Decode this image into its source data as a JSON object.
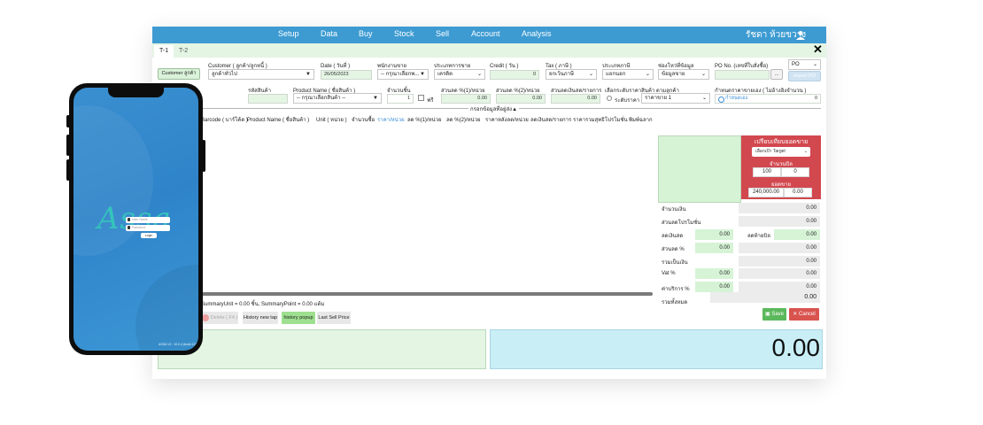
{
  "nav": {
    "items": [
      "Setup",
      "Data",
      "Buy",
      "Stock",
      "Sell",
      "Account",
      "Analysis"
    ],
    "user": "รัชดา ห้วยขวาง",
    "user_icon": "person-icon"
  },
  "tabs": [
    "T-1",
    "T-2"
  ],
  "form": {
    "customer_button": "Customer ลูกค้า",
    "customer_label": "Customer ( ลูกค้า/ลูกหนี้ )",
    "customer_value": "ลูกค้าทั่วไป",
    "date_label": "Date ( วันที่ )",
    "date_value": "26/05/2023",
    "salesperson_label": "พนักงานขาย",
    "salesperson_value": "-- กรุณาเลือกพ...",
    "sale_type_label": "ประเภทการขาย",
    "sale_type_value": "เครดิต",
    "credit_label": "Credit ( วัน )",
    "credit_value": "0",
    "tax_label": "Tax ( ภาษี )",
    "tax_value": "ยกเว้นภาษี",
    "vat_type_label": "ประเภทภาษี",
    "vat_type_value": "แยกนอก",
    "source_label": "ช่องโหว่ที่ข้อมูล",
    "source_value": "ข้อมูลขาย",
    "po_label": "PO No. (เลขที่ใบสั่งซื้อ)",
    "po_dots": "...",
    "po_type": "PO",
    "import_po": "Import PO",
    "product_code_label": "รหัสสินค้า",
    "product_name_label": "Product Name ( ชื่อสินค้า )",
    "product_name_value": "-- กรุณาเลือกสินค้า --",
    "qty_label": "จำนวนชิ้น",
    "qty_value": "1",
    "free_label": "ฟรี",
    "disc1_label": "ส่วนลด %(1)/หน่วย",
    "disc1_value": "0.00",
    "disc2_label": "ส่วนลด %(2)/หน่วย",
    "disc2_value": "0.00",
    "disc_baht_label": "ส่วนลดเงินสด/รายการ",
    "disc_baht_value": "0.00",
    "price_level_label": "เลือกระดับราคาสินค้า ตามลูกค้า",
    "price_level_radio": "ระดับราคา",
    "price_level_value": "ราคาขาย 1",
    "custom_price_label": "กำหนดราคาขายเอง ( ไม่อ้างอิงจำนวน )",
    "custom_price_radio": "กำหนดเอง",
    "custom_price_value": "0"
  },
  "collapse_label": "กรอกข้อมูลที่อยู่ส่ง▲",
  "table": {
    "headers": [
      "Barcode ( บาร์โค้ด )",
      "Product Name ( ชื่อสินค้า )",
      "Unit ( หน่วย )",
      "จำนวนซื้อ",
      "ราคา/หน่วย",
      "ลด %(1)/หน่วย",
      "ลด %(2)/หน่วย",
      "ราคาหลังลด/หน่วย",
      "ลดเงินสด/รายการ",
      "ราคารวมสุทธิ",
      "โปรโมชั่น",
      "พิมพ์ฉลาก"
    ]
  },
  "summary_line": "SummaryUnit = 0.00 ชิ้น, SummaryPoint = 0.00 แต้ม",
  "buttons": {
    "delete": "Delete ( F4 )",
    "history_new_tap": "History new tap",
    "history_popup": "history popup",
    "last_sell_price": "Last Sell Price",
    "save": "Save",
    "cancel": "Cancel"
  },
  "grand_total": "0.00",
  "target_card": {
    "title": "เปรียบเทียบยอดขาย",
    "select": "เลือกเป้า Target",
    "qty_label": "จำนวนบิล",
    "qty_target": "100",
    "qty_actual": "0",
    "amount_label": "ยอดขาย",
    "amount_target": "240,000.00",
    "amount_actual": "0.00"
  },
  "totals": {
    "amount_label": "จำนวนเงิน",
    "amount_value": "0.00",
    "promo_label": "ส่วนลดโปรโมชั่น",
    "promo_value": "0.00",
    "cash_disc_label": "ลดเงินสด",
    "cash_disc_value": "0.00",
    "end_disc_label": "ลดท้ายบิล",
    "end_disc_value": "0.00",
    "pct_disc_label": "ส่วนลด %",
    "pct_disc_input": "0.00",
    "pct_disc_value": "0.00",
    "subtotal_label": "รวมเป็นเงิน",
    "subtotal_value": "0.00",
    "vat_label": "Vat %",
    "vat_input": "0.00",
    "vat_value": "0.00",
    "service_label": "ค่าบริการ %",
    "service_input": "0.00",
    "service_value": "0.00",
    "net_label": "รวมทั้งหมด",
    "net_value": "0.00"
  },
  "phone": {
    "logo": "Assa",
    "username_placeholder": "User Name",
    "password_placeholder": "Password",
    "login_button": "Login",
    "version": "ASSA V2 : 10.0.4 (build 123)"
  },
  "colors": {
    "nav": "#3d9bd2",
    "field_bg": "#e4f5e4",
    "target_card": "#d2484f",
    "save": "#5cb85c",
    "cancel": "#d9534f",
    "total_box": "#c9eef6"
  }
}
